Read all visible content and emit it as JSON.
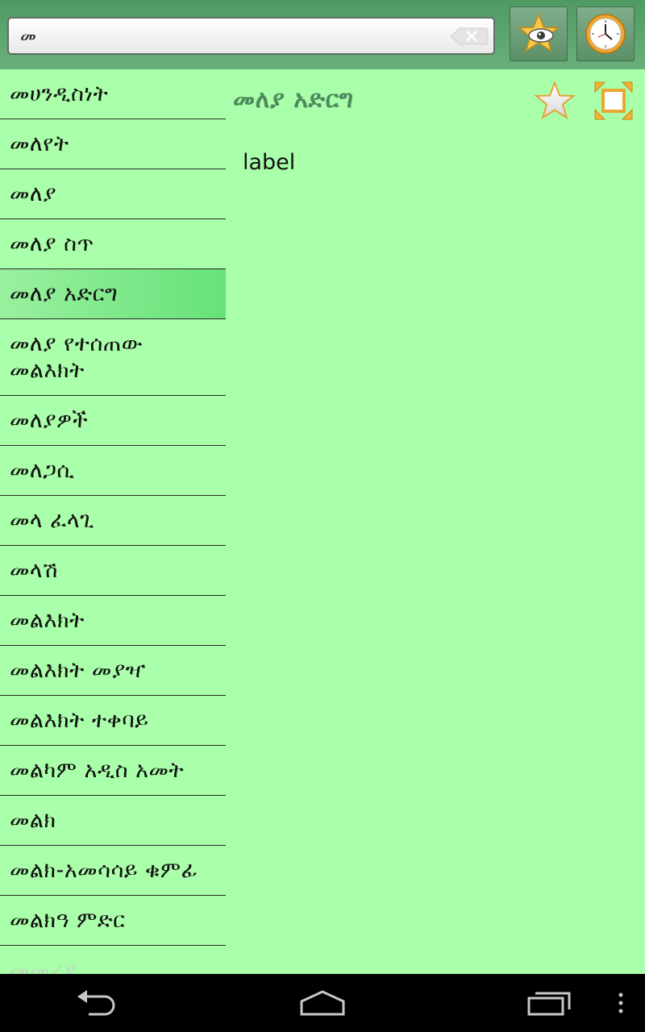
{
  "search": {
    "value": "መ",
    "placeholder": ""
  },
  "toolbar": {
    "favorites_icon": "star-eye-icon",
    "history_icon": "clock-icon"
  },
  "word_list": [
    {
      "label": "መሀንዲስነት"
    },
    {
      "label": "መለየት"
    },
    {
      "label": "መለያ"
    },
    {
      "label": "መለያ ስጥ"
    },
    {
      "label": "መለያ አድርግ",
      "selected": true
    },
    {
      "label": "መለያ የተሰጠው መልእክት"
    },
    {
      "label": "መለያዎች"
    },
    {
      "label": "መለጋሲ"
    },
    {
      "label": "መላ ፈላጊ"
    },
    {
      "label": "መላሽ"
    },
    {
      "label": "መልእክት"
    },
    {
      "label": "መልእክት መያዣ"
    },
    {
      "label": "መልእክት ተቀባይ"
    },
    {
      "label": "መልካም አዲስ አመት"
    },
    {
      "label": "መልክ"
    },
    {
      "label": "መልክ-አመሳሳይ ቁምፊ"
    },
    {
      "label": "መልክዓ ምድር"
    },
    {
      "label": "መመሪያ",
      "partial": true
    }
  ],
  "detail": {
    "title": "መለያ አድርግ",
    "translation": "label"
  },
  "colors": {
    "background": "#aaffaa",
    "topbar": "#5a9f6d",
    "selected": "#66e27a",
    "title": "#4e8a5e"
  }
}
